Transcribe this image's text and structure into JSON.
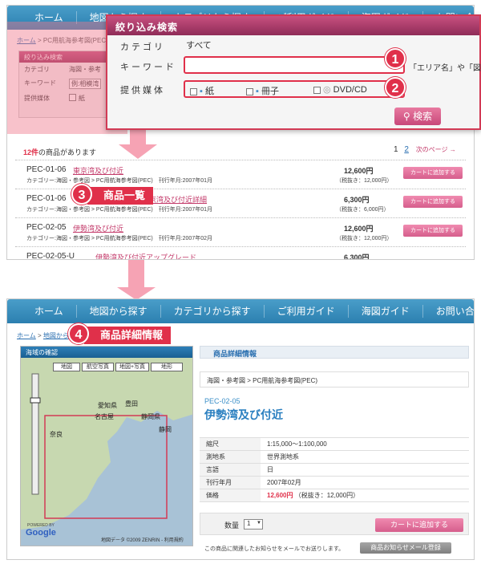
{
  "nav": {
    "items": [
      "ホーム",
      "地図から探す",
      "カテゴリから探す",
      "ご利用ガイド",
      "海図ガイド",
      "お問い合わせ"
    ]
  },
  "list_page": {
    "breadcrumb": {
      "home": "ホーム",
      "current": "PC用航海参考図(PEC)"
    },
    "mini_search": {
      "title": "絞り込み検索",
      "rows": [
        {
          "label": "カテゴリ",
          "value": "海図・参考"
        },
        {
          "label": "キーワード",
          "value": "例:相模湾"
        },
        {
          "label": "提供媒体",
          "value": "紙"
        }
      ]
    },
    "count": {
      "num": "12件",
      "text": "の商品があります"
    },
    "pagination": {
      "p1": "1",
      "p2": "2",
      "next": "次のページ →"
    },
    "rows": [
      {
        "code": "PEC-01-06",
        "name": "東京湾及び付近",
        "meta": "カテゴリー:海図・参考図 > PC用航海参考図(PEC)　刊行年月:2007年01月",
        "price": "12,600円",
        "tax": "（税抜き：12,000円）",
        "cart": "カートに追加する"
      },
      {
        "code": "PEC-01-06",
        "name": "東京湾及び付近詳細",
        "meta": "カテゴリー:海図・参考図 > PC用航海参考図(PEC)　刊行年月:2007年01月",
        "price": "6,300円",
        "tax": "（税抜き：6,000円）",
        "cart": "カートに追加する"
      },
      {
        "code": "PEC-02-05",
        "name": "伊勢湾及び付近",
        "meta": "カテゴリー:海図・参考図 > PC用航海参考図(PEC)　刊行年月:2007年02月",
        "price": "12,600円",
        "tax": "（税抜き：12,000円）",
        "cart": "カートに追加する"
      },
      {
        "code": "PEC-02-05-U",
        "name": "伊勢湾及び付近アップグレード",
        "meta": "",
        "price": "6,300円",
        "tax": "",
        "cart": ""
      }
    ]
  },
  "popup": {
    "title": "絞り込み検索",
    "category_label": "カテゴリ",
    "category_value": "すべて",
    "keyword_label": "キーワード",
    "keyword_value": "",
    "keyword_hint": "「エリア名」や「図の種",
    "media_label": "提供媒体",
    "media": [
      "紙",
      "冊子",
      "DVD/CD"
    ],
    "search_button": "検索"
  },
  "callouts": {
    "b1": "1",
    "b2": "2",
    "b3": "3",
    "b4": "4",
    "t3": "商品一覧",
    "t4": "商品詳細情報"
  },
  "detail_page": {
    "breadcrumb": {
      "home": "ホーム",
      "next": "地図から"
    },
    "map": {
      "title": "海域の確認",
      "tabs": [
        "地図",
        "航空写真",
        "地図+写真",
        "地形"
      ],
      "credit": "地図データ ©2009 ZENRIN - 利用規約",
      "powered": "POWERED BY",
      "google": "Google",
      "places": [
        {
          "name": "名古屋"
        },
        {
          "name": "静岡県"
        },
        {
          "name": "豊田"
        },
        {
          "name": "愛知県"
        },
        {
          "name": "奈良"
        },
        {
          "name": "静岡"
        }
      ]
    },
    "section_title": "商品詳細情報",
    "category_path": "海図・参考図 > PC用航海参考図(PEC)",
    "code": "PEC-02-05",
    "name": "伊勢湾及び付近",
    "specs": [
      {
        "k": "縮尺",
        "v": "1:15,000～1:100,000"
      },
      {
        "k": "測地系",
        "v": "世界測地系"
      },
      {
        "k": "言語",
        "v": "日"
      },
      {
        "k": "刊行年月",
        "v": "2007年02月"
      }
    ],
    "price_label": "価格",
    "price": "12,600円",
    "price_tax": "（税抜き：12,000円）",
    "qty_label": "数量",
    "qty_value": "1",
    "cart": "カートに追加する",
    "notice": "この商品に関連したお知らせをメールでお送りします。",
    "notice_button": "商品お知らせメール登録"
  },
  "colors": {
    "nav": "#2c7fb0",
    "accent": "#e0304a",
    "pink": "#c8487a",
    "link": "#2a6fb0"
  }
}
